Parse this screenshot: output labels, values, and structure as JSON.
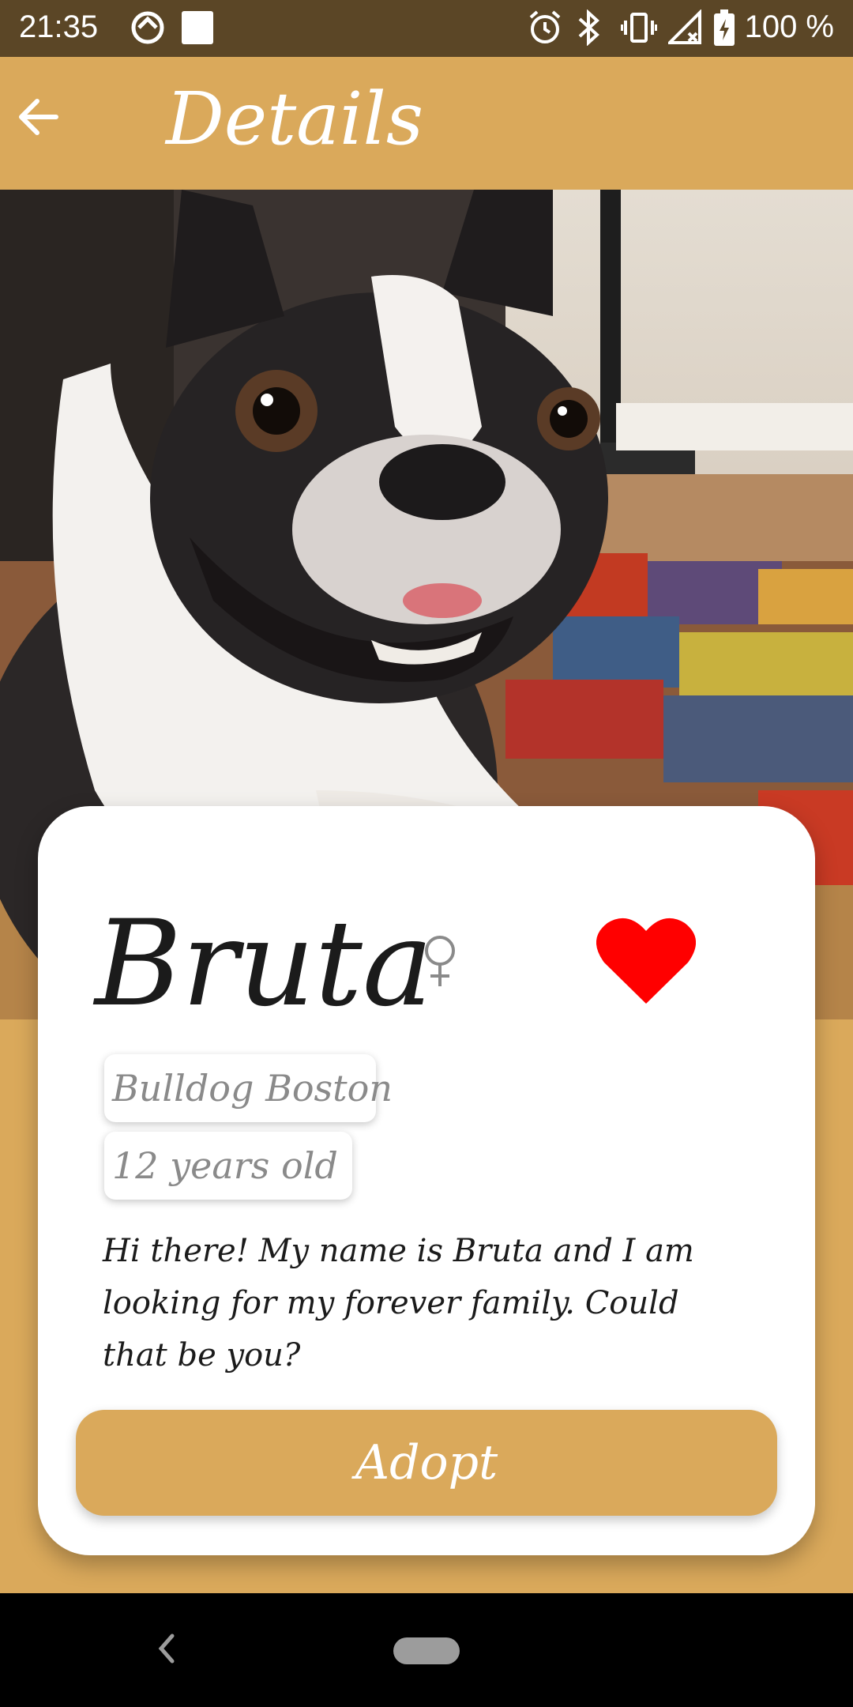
{
  "status_bar": {
    "time": "21:35",
    "battery": "100 %",
    "icons": [
      "sync-icon",
      "square-notification-icon",
      "alarm-icon",
      "bluetooth-icon",
      "vibrate-icon",
      "signal-off-icon",
      "battery-charging-icon"
    ]
  },
  "app_bar": {
    "title": "Details",
    "back_icon": "arrow-left-icon"
  },
  "pet": {
    "name": "Bruta",
    "sex_icon": "female-icon",
    "favorite_icon": "heart-icon",
    "favorite_color": "#FF0000",
    "breed": "Bulldog Boston",
    "age": "12 years old",
    "description": "Hi there! My name is Bruta and I am looking for my forever family. Could that be you?"
  },
  "actions": {
    "adopt_label": "Adopt"
  },
  "colors": {
    "accent": "#DAA95B",
    "status_bar": "#5B4626"
  }
}
